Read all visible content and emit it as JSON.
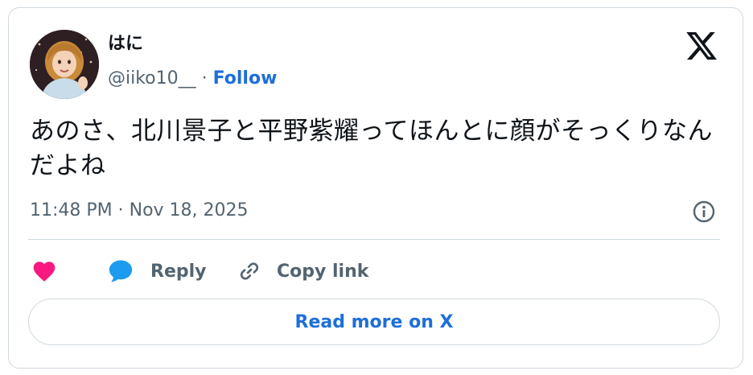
{
  "author": {
    "display_name": "はに",
    "handle": "@iiko10__",
    "separator": " · ",
    "follow_label": "Follow"
  },
  "tweet": {
    "text": "あのさ、北川景子と平野紫耀ってほんとに顔がそっくりなんだよね",
    "timestamp": "11:48 PM · Nov 18, 2025"
  },
  "actions": {
    "like_icon": "heart-icon",
    "reply_label": "Reply",
    "reply_icon": "speech-bubble-icon",
    "copy_label": "Copy link",
    "copy_icon": "link-icon"
  },
  "read_more_label": "Read more on X",
  "colors": {
    "link_blue": "#1d6fd9",
    "like_pink": "#f91880",
    "reply_blue": "#1d9bf0",
    "muted_gray": "#536471",
    "border": "#cfd9de"
  }
}
